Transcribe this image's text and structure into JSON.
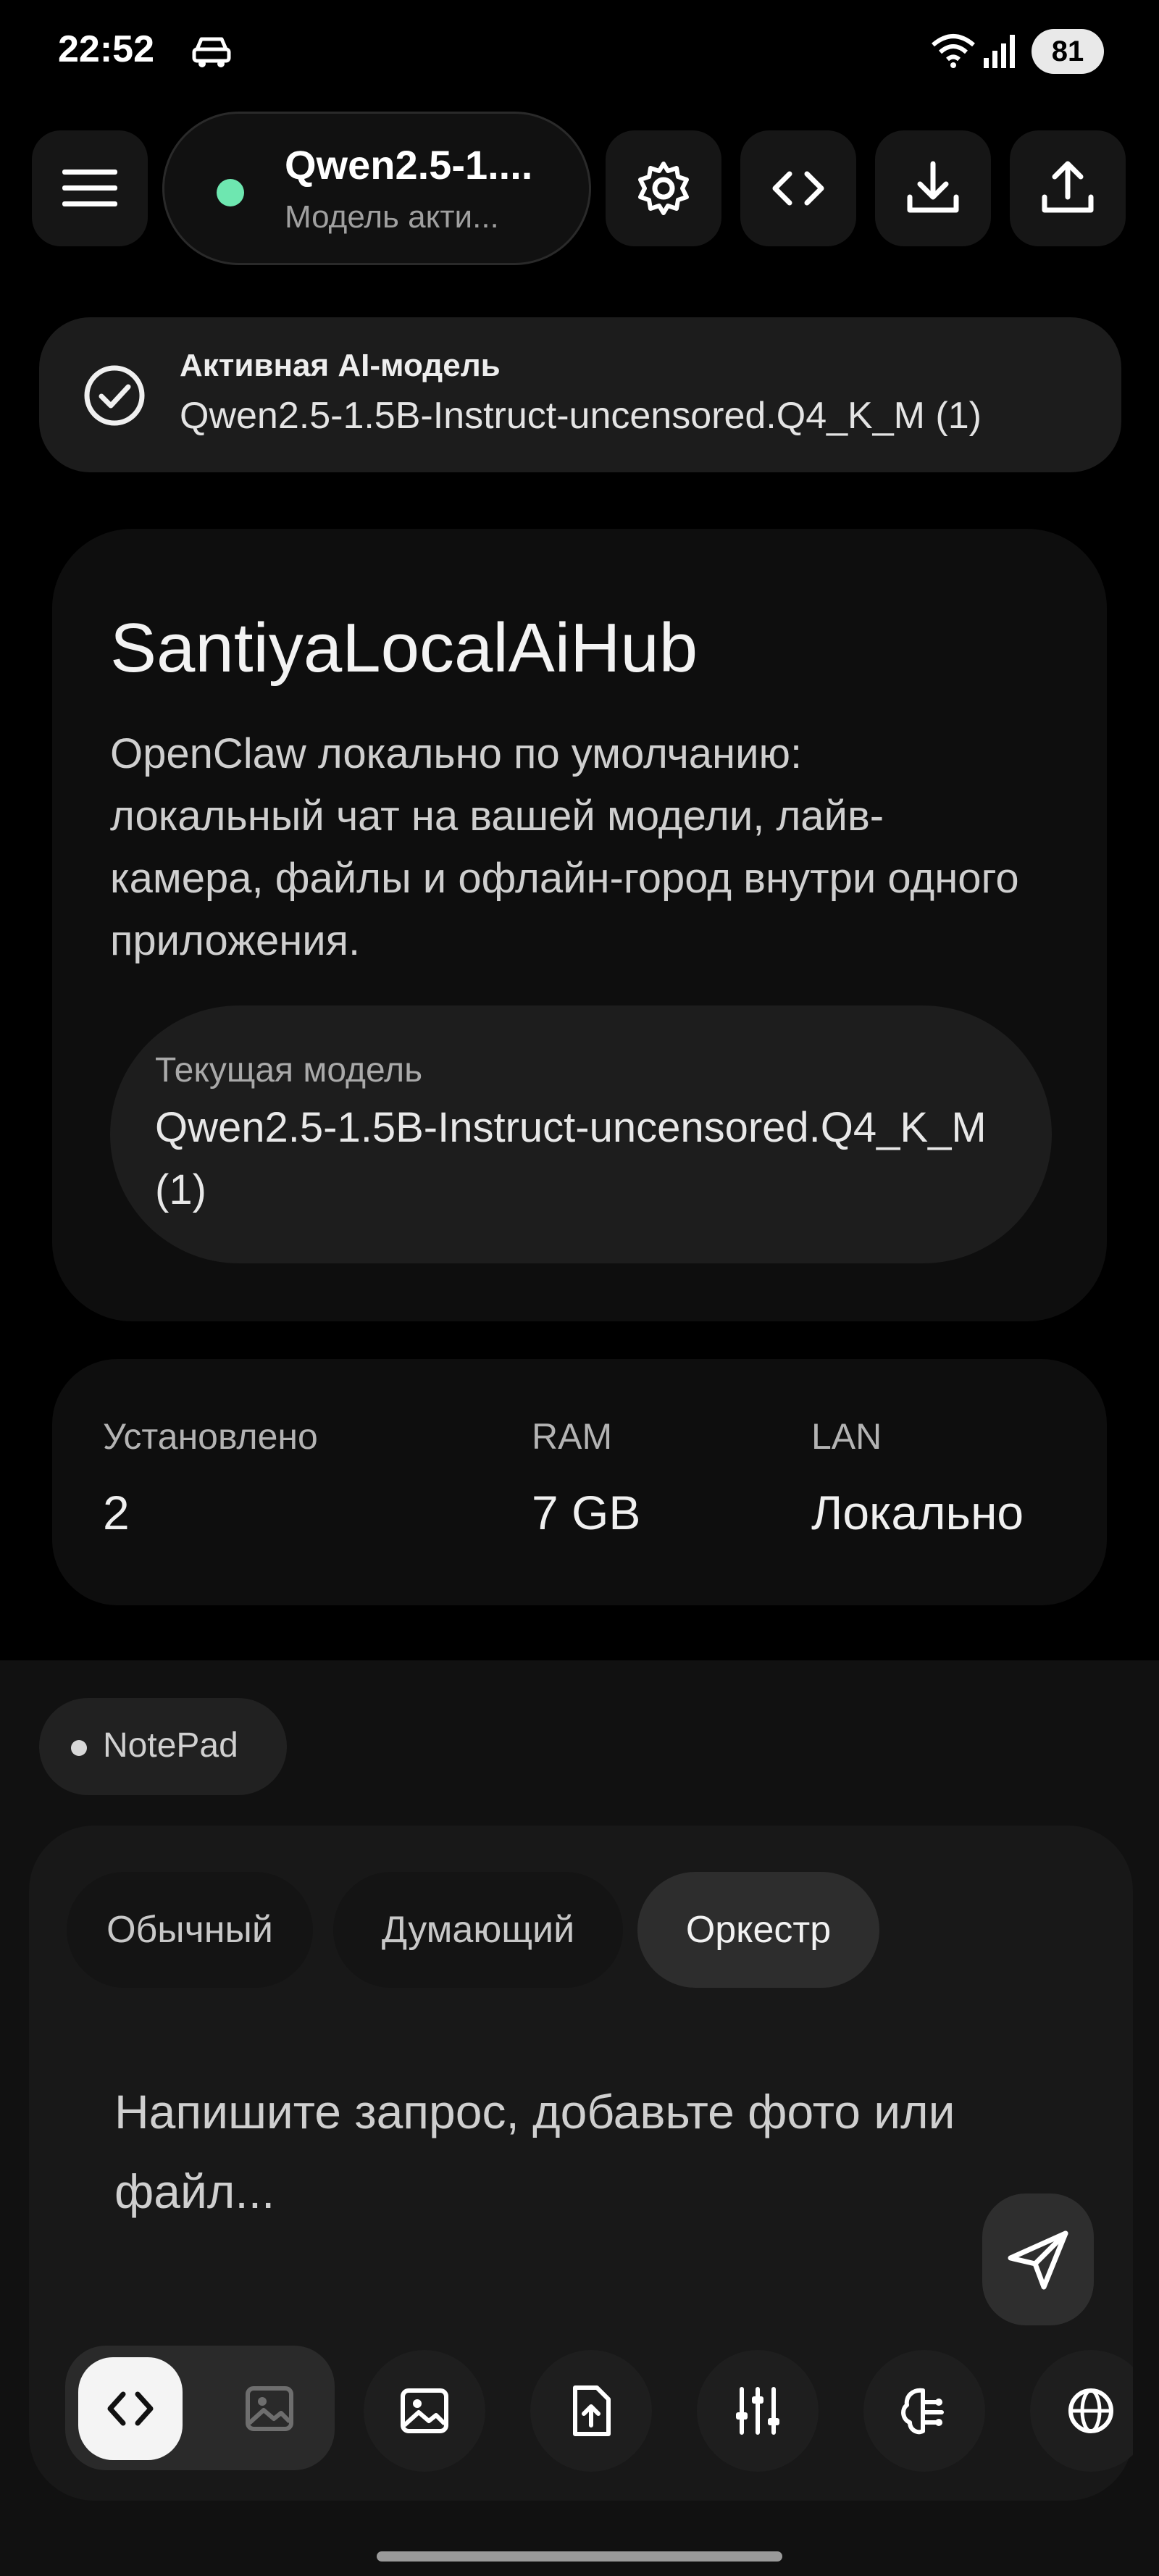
{
  "status_bar": {
    "time": "22:52",
    "battery": "81",
    "icons": [
      "car-mode-icon",
      "wifi-icon",
      "signal-icon"
    ]
  },
  "toolbar": {
    "menu_icon": "hamburger-menu-icon",
    "model_name": "Qwen2.5-1....",
    "model_status": "Модель акти...",
    "status_color": "#6ee7b0",
    "buttons": [
      "settings-gear-icon",
      "code-brackets-icon",
      "download-icon",
      "upload-icon"
    ]
  },
  "active_banner": {
    "title": "Активная AI-модель",
    "value": "Qwen2.5-1.5B-Instruct-uncensored.Q4_K_M (1)"
  },
  "hero": {
    "title": "SantiyaLocalAiHub",
    "description": "OpenClaw локально по умолчанию: локальный чат на вашей модели, лайв-камера, файлы и офлайн-город внутри одного приложения.",
    "chip_label": "Текущая модель",
    "chip_value": "Qwen2.5-1.5B-Instruct-uncensored.Q4_K_M (1)"
  },
  "stats": [
    {
      "label": "Установлено",
      "value": "2"
    },
    {
      "label": "RAM",
      "value": "7 GB"
    },
    {
      "label": "LAN",
      "value": "Локально"
    }
  ],
  "composer": {
    "notepad_label": "NotePad",
    "modes": [
      {
        "label": "Обычный",
        "active": false
      },
      {
        "label": "Думающий",
        "active": false
      },
      {
        "label": "Оркестр",
        "active": true
      }
    ],
    "placeholder": "Напишите запрос, добавьте фото или файл...",
    "send_icon": "send-icon",
    "tools": [
      "code-toggle-icon",
      "image-toggle-icon",
      "image-attach-icon",
      "file-upload-icon",
      "sliders-icon",
      "brain-icon",
      "globe-icon"
    ]
  }
}
